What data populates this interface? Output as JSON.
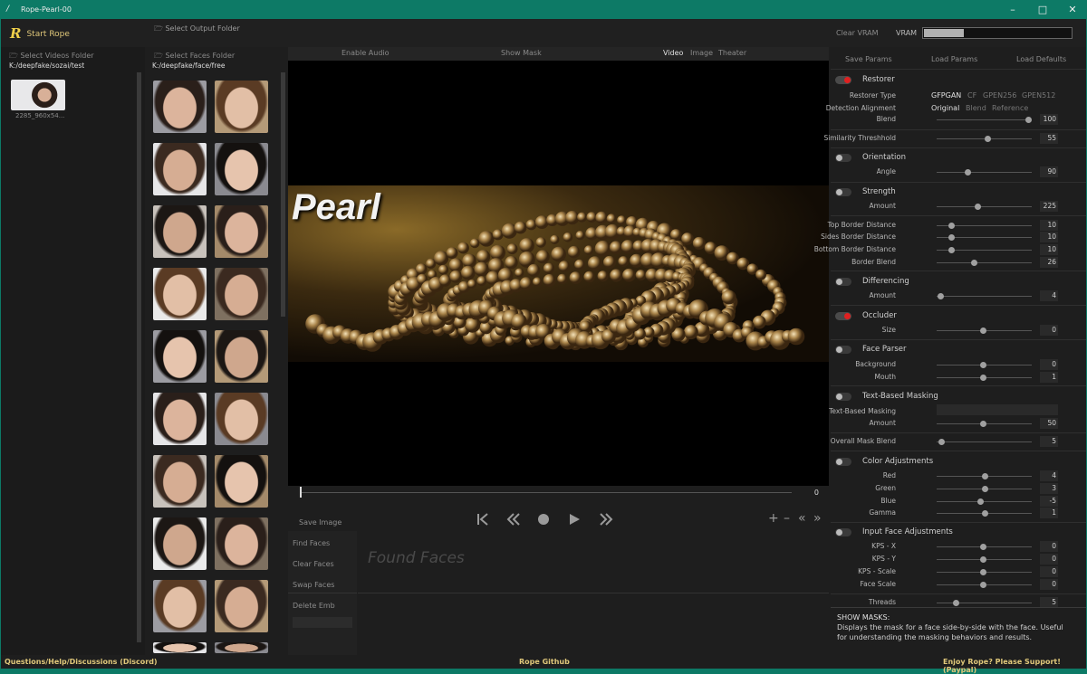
{
  "window": {
    "title": "Rope-Pearl-00",
    "app_icon": "rope-icon"
  },
  "toolbar": {
    "start_rope": "Start Rope",
    "logo_letter": "R",
    "select_output_folder": "Select Output Folder",
    "clear_vram": "Clear VRAM",
    "vram_label": "VRAM",
    "vram_usage": 0.27
  },
  "videos": {
    "select_label": "Select Videos Folder",
    "path": "K:/deepfake/sozai/test",
    "items": [
      {
        "caption": "2285_960x54..."
      }
    ]
  },
  "faces": {
    "select_label": "Select Faces Folder",
    "path": "K:/deepfake/face/free",
    "count_visible": 20
  },
  "view": {
    "enable_audio": "Enable Audio",
    "show_mask": "Show Mask",
    "tabs": [
      "Video",
      "Image",
      "Theater"
    ],
    "active_tab": "Video",
    "banner_text": "Pearl",
    "frame": "0"
  },
  "playback": {
    "save_image": "Save Image"
  },
  "found": {
    "find_faces": "Find Faces",
    "clear_faces": "Clear Faces",
    "swap_faces": "Swap Faces",
    "delete_emb": "Delete Emb",
    "placeholder": "Found Faces"
  },
  "params": {
    "save_params": "Save Params",
    "load_params": "Load Params",
    "load_defaults": "Load Defaults"
  },
  "restorer": {
    "title": "Restorer",
    "enabled": true,
    "type_label": "Restorer Type",
    "types": [
      "GFPGAN",
      "CF",
      "GPEN256",
      "GPEN512"
    ],
    "align_label": "Detection Alignment",
    "aligns": [
      "Original",
      "Blend",
      "Reference"
    ],
    "blend_label": "Blend",
    "blend": "100"
  },
  "similarity": {
    "label": "Similarity Threshhold",
    "value": "55"
  },
  "orientation": {
    "title": "Orientation",
    "enabled": false,
    "angle_label": "Angle",
    "angle": "90"
  },
  "strength": {
    "title": "Strength",
    "enabled": false,
    "amount_label": "Amount",
    "amount": "225"
  },
  "border": {
    "top_label": "Top Border Distance",
    "top": "10",
    "sides_label": "Sides Border Distance",
    "sides": "10",
    "bottom_label": "Bottom Border Distance",
    "bottom": "10",
    "blend_label": "Border Blend",
    "blend": "26"
  },
  "differencing": {
    "title": "Differencing",
    "enabled": false,
    "amount_label": "Amount",
    "amount": "4"
  },
  "occluder": {
    "title": "Occluder",
    "enabled": true,
    "size_label": "Size",
    "size": "0"
  },
  "face_parser": {
    "title": "Face Parser",
    "enabled": false,
    "background_label": "Background",
    "background": "0",
    "mouth_label": "Mouth",
    "mouth": "1"
  },
  "text_mask": {
    "title": "Text-Based Masking",
    "enabled": false,
    "field_label": "Text-Based Masking",
    "amount_label": "Amount",
    "amount": "50"
  },
  "overall": {
    "label": "Overall Mask Blend",
    "value": "5"
  },
  "color": {
    "title": "Color Adjustments",
    "enabled": false,
    "red_label": "Red",
    "red": "4",
    "green_label": "Green",
    "green": "3",
    "blue_label": "Blue",
    "blue": "-5",
    "gamma_label": "Gamma",
    "gamma": "1"
  },
  "input_face": {
    "title": "Input Face Adjustments",
    "enabled": false,
    "kpsx_label": "KPS - X",
    "kpsx": "0",
    "kpsy_label": "KPS - Y",
    "kpsy": "0",
    "kpss_label": "KPS - Scale",
    "kpss": "0",
    "fs_label": "Face Scale",
    "fs": "0"
  },
  "threads": {
    "label": "Threads",
    "value": "5"
  },
  "info": {
    "title": "SHOW MASKS:",
    "text": "Displays the mask for a face side-by-side with the face. Useful for understanding the masking behaviors and results."
  },
  "footer": {
    "left": "Questions/Help/Discussions (Discord)",
    "center": "Rope Github",
    "right": "Enjoy Rope? Please Support! (Paypal)"
  }
}
